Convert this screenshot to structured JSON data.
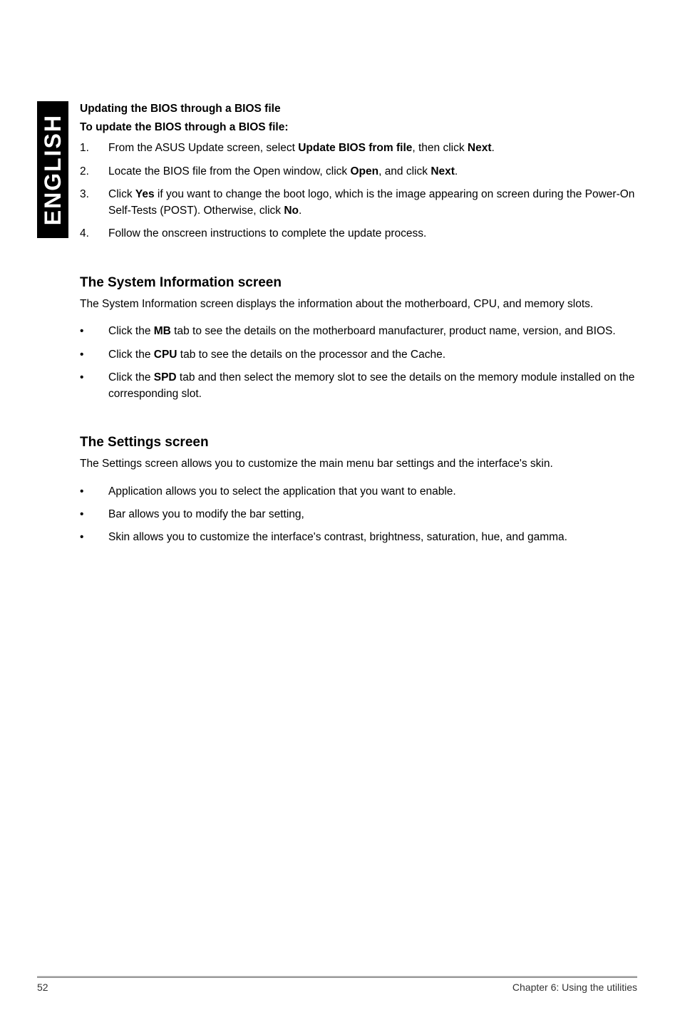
{
  "sidebar": {
    "language": "ENGLISH"
  },
  "section1": {
    "heading1": "Updating the BIOS through a BIOS file",
    "heading2": "To update the BIOS through a BIOS file:",
    "steps": [
      {
        "num": "1.",
        "pre": "From the ASUS Update screen, select ",
        "bold1": "Update BIOS from file",
        "mid1": ", then click ",
        "bold2": "Next",
        "post": "."
      },
      {
        "num": "2.",
        "pre": "Locate the BIOS file from the Open window, click ",
        "bold1": "Open",
        "mid1": ", and click ",
        "bold2": "Next",
        "post": "."
      },
      {
        "num": "3.",
        "pre": "Click ",
        "bold1": "Yes",
        "mid1": " if you want to change the boot logo, which is the image appearing on screen during the Power-On Self-Tests (POST). Otherwise, click ",
        "bold2": "No",
        "post": "."
      },
      {
        "num": "4.",
        "pre": "Follow the onscreen instructions to complete the update process.",
        "bold1": "",
        "mid1": "",
        "bold2": "",
        "post": ""
      }
    ]
  },
  "section2": {
    "heading": "The System Information screen",
    "intro": "The System Information screen displays the information about the motherboard, CPU, and memory slots.",
    "bullets": [
      {
        "pre": "Click the ",
        "bold": "MB",
        "post": " tab to see the details on the motherboard manufacturer, product name, version, and BIOS."
      },
      {
        "pre": "Click the ",
        "bold": "CPU",
        "post": " tab to see the details on the processor and the Cache."
      },
      {
        "pre": "Click the ",
        "bold": "SPD",
        "post": " tab and then select the memory slot to see the details on the memory module installed on the corresponding slot."
      }
    ]
  },
  "section3": {
    "heading": "The Settings screen",
    "intro": "The Settings screen allows you to customize the main menu bar settings and the interface's skin.",
    "bullets": [
      {
        "text": "Application allows you to select the application that you want to enable."
      },
      {
        "text": "Bar allows you to modify the bar setting,"
      },
      {
        "text": "Skin allows you to customize the interface's contrast, brightness, saturation, hue, and gamma."
      }
    ]
  },
  "footer": {
    "page": "52",
    "chapter": "Chapter 6: Using the utilities"
  }
}
